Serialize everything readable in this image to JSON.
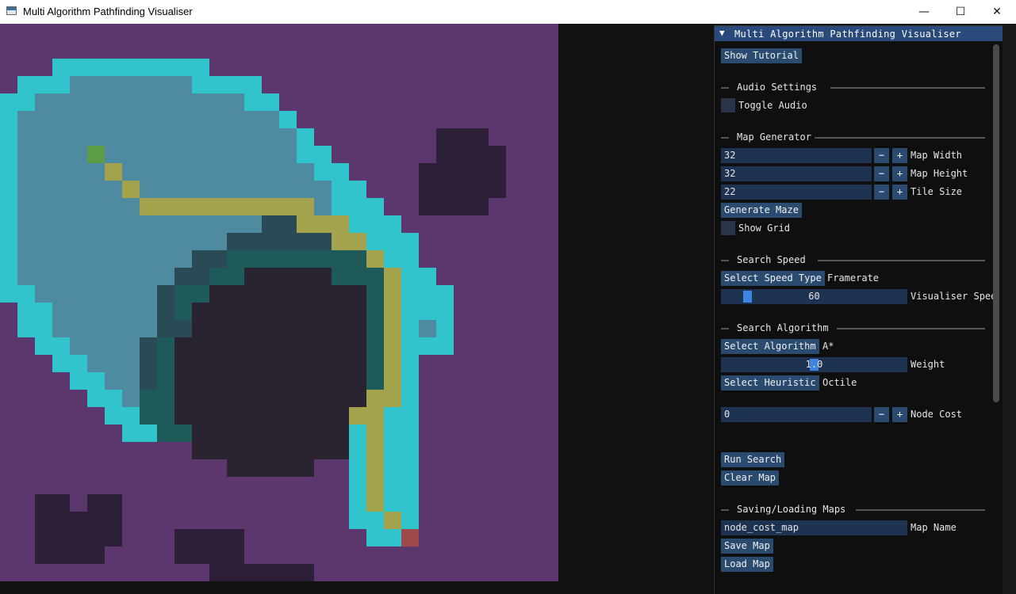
{
  "window": {
    "title": "Multi Algorithm Pathfinding Visualiser",
    "minimize_glyph": "—",
    "maximize_glyph": "☐",
    "close_glyph": "✕"
  },
  "colors": {
    "background": "#5b376e",
    "wall": "#2d1f38",
    "path": "#a3a34e",
    "start": "#5c9c45",
    "end": "#9e4a4a",
    "frontier": "#32c4cc",
    "visited": "#4e8aa0",
    "visited_dim": "#305860",
    "visited_dark": "#2a4a55",
    "teal": "#1f5a5a",
    "panel_header": "#294a7a",
    "button": "#2a4a70",
    "frame": "#1e3252",
    "slider_grab": "#3d85e0"
  },
  "map": {
    "cols": 32,
    "rows": 32,
    "cells": [
      "................................",
      "................................",
      "...FFFFFFFFF....................",
      ".FFFVVVVVVVFFFF.................",
      "FFVVVVVVVVVVVVFF................",
      "FVVVVVVVVVVVVVVVF...............",
      "FVVVVVVVVVVVVVVVVF.......WWW....",
      "FVVVVSVVVVVVVVVVVFF......WWWW...",
      "FVVVVVPVVVVVVVVVVVFF....WWWWW...",
      "FVVVVVVPVVVVVVVVVVVFF...WWWWW...",
      "FVVVVVVVPPPPPPPPPPVFFF..WWWW....",
      "FVVVVVVVVVVVVVVDDPPPFFF.........",
      "FVVVVVVVVVVVVDDDDDDPPFFF........",
      "FVVVVVVVVVVDDTTTTTTTTPFF........",
      "FVVVVVVVVVDDTTKKKKKTTTPFF.......",
      "FFVVVVVVVDTTKKKKKKKKKTPFFF......",
      ".FFVVVVVVDTKKKKKKKKKKTPFFF......",
      ".FFVVVVVVDDKKKKKKKKKKTPFVF......",
      "..FFVVVVDTKKKKKKKKKKKTPFFF......",
      "...FFVVVDTKKKKKKKKKKKTPF........",
      "....FFVVDTKKKKKKKKKKKTPF........",
      ".....FFVTTKKKKKKKKKKKPPF........",
      "......FFTTKKKKKKKKKKPPFF........",
      ".......FFTTKKKKKKKKKFPFF........",
      "...........KKKKKKKKKFPFF........",
      ".............KKKKK..FPFF........",
      "....................FPFF........",
      "..WW.WW.............FPFF........",
      "..WWWWW.............FFPF........",
      "..WWWWW...WWWW.......FFE........",
      "..WWWW....WWWW..................",
      "............WWWWWW.............."
    ]
  },
  "panel": {
    "header_title": "Multi Algorithm Pathfinding Visualiser",
    "collapse_glyph": "▼",
    "show_tutorial": "Show Tutorial",
    "audio": {
      "title": "Audio Settings",
      "toggle_label": "Toggle Audio"
    },
    "generator": {
      "title": "Map Generator",
      "map_width_value": "32",
      "map_width_label": "Map Width",
      "map_height_value": "32",
      "map_height_label": "Map Height",
      "tile_size_value": "22",
      "tile_size_label": "Tile Size",
      "generate_maze": "Generate Maze",
      "show_grid": "Show Grid",
      "minus": "−",
      "plus": "+"
    },
    "speed": {
      "title": "Search Speed",
      "select_button": "Select Speed Type",
      "selected_type": "Framerate",
      "slider_value": "60",
      "slider_label": "Visualiser Spee",
      "slider_level": 0.12
    },
    "algorithm": {
      "title": "Search Algorithm",
      "select_button": "Select Algorithm",
      "selected": "A*",
      "weight_value": "1.0",
      "weight_label": "Weight",
      "weight_level": 0.5,
      "heuristic_button": "Select Heuristic",
      "heuristic": "Octile",
      "node_cost_value": "0",
      "node_cost_label": "Node Cost"
    },
    "actions": {
      "run_search": "Run Search",
      "clear_map": "Clear Map"
    },
    "saving": {
      "title": "Saving/Loading Maps",
      "map_name_value": "node_cost_map",
      "map_name_label": "Map Name",
      "save_map": "Save Map",
      "load_map": "Load Map"
    }
  }
}
